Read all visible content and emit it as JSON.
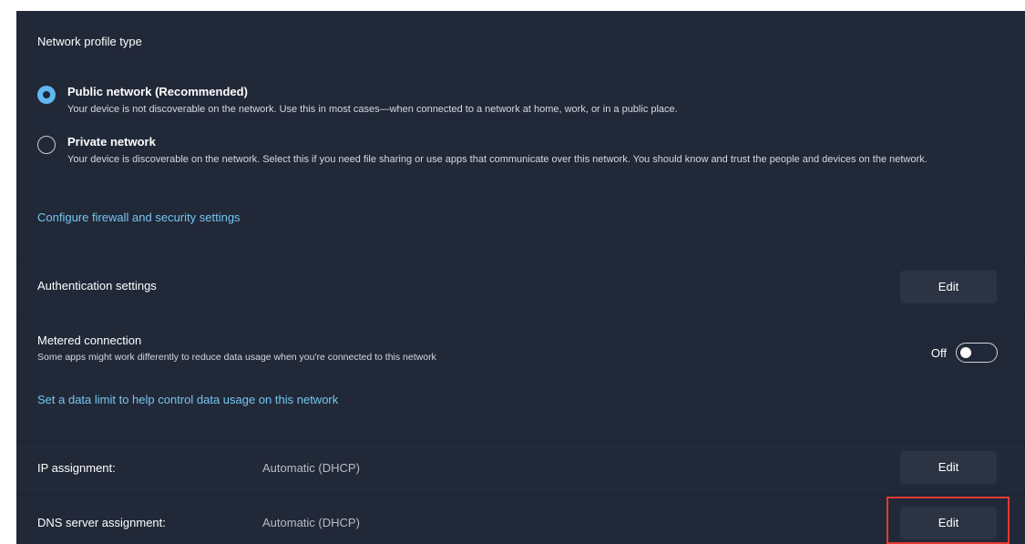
{
  "network_profile": {
    "title": "Network profile type",
    "options": [
      {
        "label": "Public network (Recommended)",
        "description": "Your device is not discoverable on the network. Use this in most cases—when connected to a network at home, work, or in a public place.",
        "selected": true
      },
      {
        "label": "Private network",
        "description": "Your device is discoverable on the network. Select this if you need file sharing or use apps that communicate over this network. You should know and trust the people and devices on the network.",
        "selected": false
      }
    ],
    "firewall_link": "Configure firewall and security settings"
  },
  "authentication": {
    "label": "Authentication settings",
    "button": "Edit"
  },
  "metered": {
    "label": "Metered connection",
    "description": "Some apps might work differently to reduce data usage when you're connected to this network",
    "toggle_state": "Off",
    "data_limit_link": "Set a data limit to help control data usage on this network"
  },
  "ip_assignment": {
    "label": "IP assignment:",
    "value": "Automatic (DHCP)",
    "button": "Edit"
  },
  "dns_assignment": {
    "label": "DNS server assignment:",
    "value": "Automatic (DHCP)",
    "button": "Edit"
  },
  "colors": {
    "background": "#1e2535",
    "accent": "#61b7f0",
    "link": "#75c7f0",
    "highlight": "#e23a2e"
  }
}
